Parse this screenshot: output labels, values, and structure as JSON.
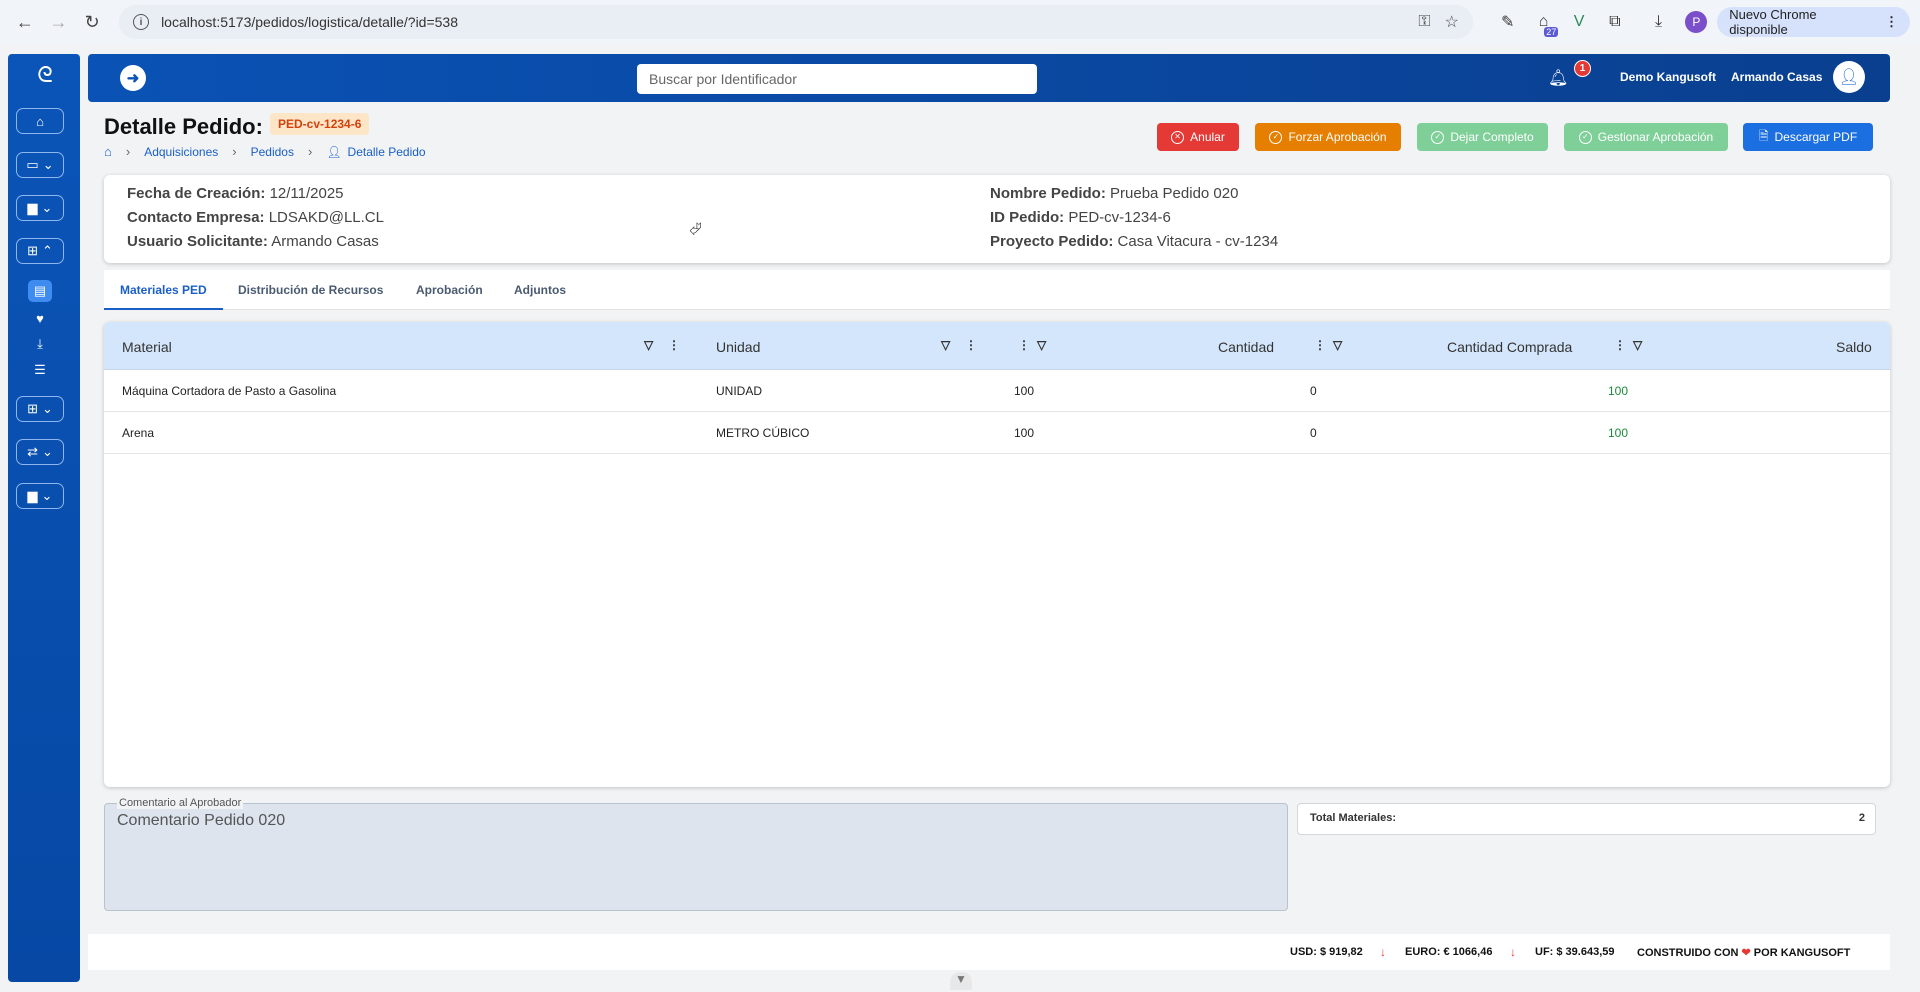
{
  "browser": {
    "url": "localhost:5173/pedidos/logistica/detalle/?id=538",
    "extension_badge": "27",
    "profile_initial": "P",
    "update_label": "Nuevo Chrome disponible"
  },
  "header": {
    "search_placeholder": "Buscar por Identificador",
    "notification_count": "1",
    "company": "Demo Kangusoft",
    "user": "Armando Casas"
  },
  "page": {
    "title": "Detalle Pedido:",
    "id_chip": "PED-cv-1234-6",
    "breadcrumb": [
      "Adquisiciones",
      "Pedidos",
      "Detalle Pedido"
    ]
  },
  "actions": {
    "anular": "Anular",
    "forzar": "Forzar Aprobación",
    "dejar": "Dejar Completo",
    "gestionar": "Gestionar Aprobación",
    "descargar": "Descargar PDF"
  },
  "info": {
    "fecha_label": "Fecha de Creación:",
    "fecha": "12/11/2025",
    "contacto_label": "Contacto Empresa:",
    "contacto": "LDSAKD@LL.CL",
    "usuario_label": "Usuario Solicitante:",
    "usuario": "Armando Casas",
    "nombre_label": "Nombre Pedido:",
    "nombre": "Prueba Pedido 020",
    "id_label": "ID Pedido:",
    "id": "PED-cv-1234-6",
    "proyecto_label": "Proyecto Pedido:",
    "proyecto": "Casa Vitacura - cv-1234"
  },
  "tabs": [
    "Materiales PED",
    "Distribución de Recursos",
    "Aprobación",
    "Adjuntos"
  ],
  "table": {
    "columns": [
      "Material",
      "Unidad",
      "Cantidad",
      "Cantidad Comprada",
      "Saldo"
    ],
    "rows": [
      {
        "material": "Máquina Cortadora de Pasto a Gasolina",
        "unidad": "UNIDAD",
        "cantidad": "100",
        "comprada": "0",
        "saldo": "100"
      },
      {
        "material": "Arena",
        "unidad": "METRO CÚBICO",
        "cantidad": "100",
        "comprada": "0",
        "saldo": "100"
      }
    ]
  },
  "comment": {
    "legend": "Comentario al Aprobador",
    "text": "Comentario Pedido 020"
  },
  "totals": {
    "label": "Total Materiales:",
    "value": "2"
  },
  "footer": {
    "usd": "USD: $ 919,82",
    "euro": "EURO: € 1066,46",
    "uf": "UF: $ 39.643,59",
    "built_prefix": "CONSTRUIDO CON",
    "built_suffix": "POR KANGUSOFT"
  }
}
